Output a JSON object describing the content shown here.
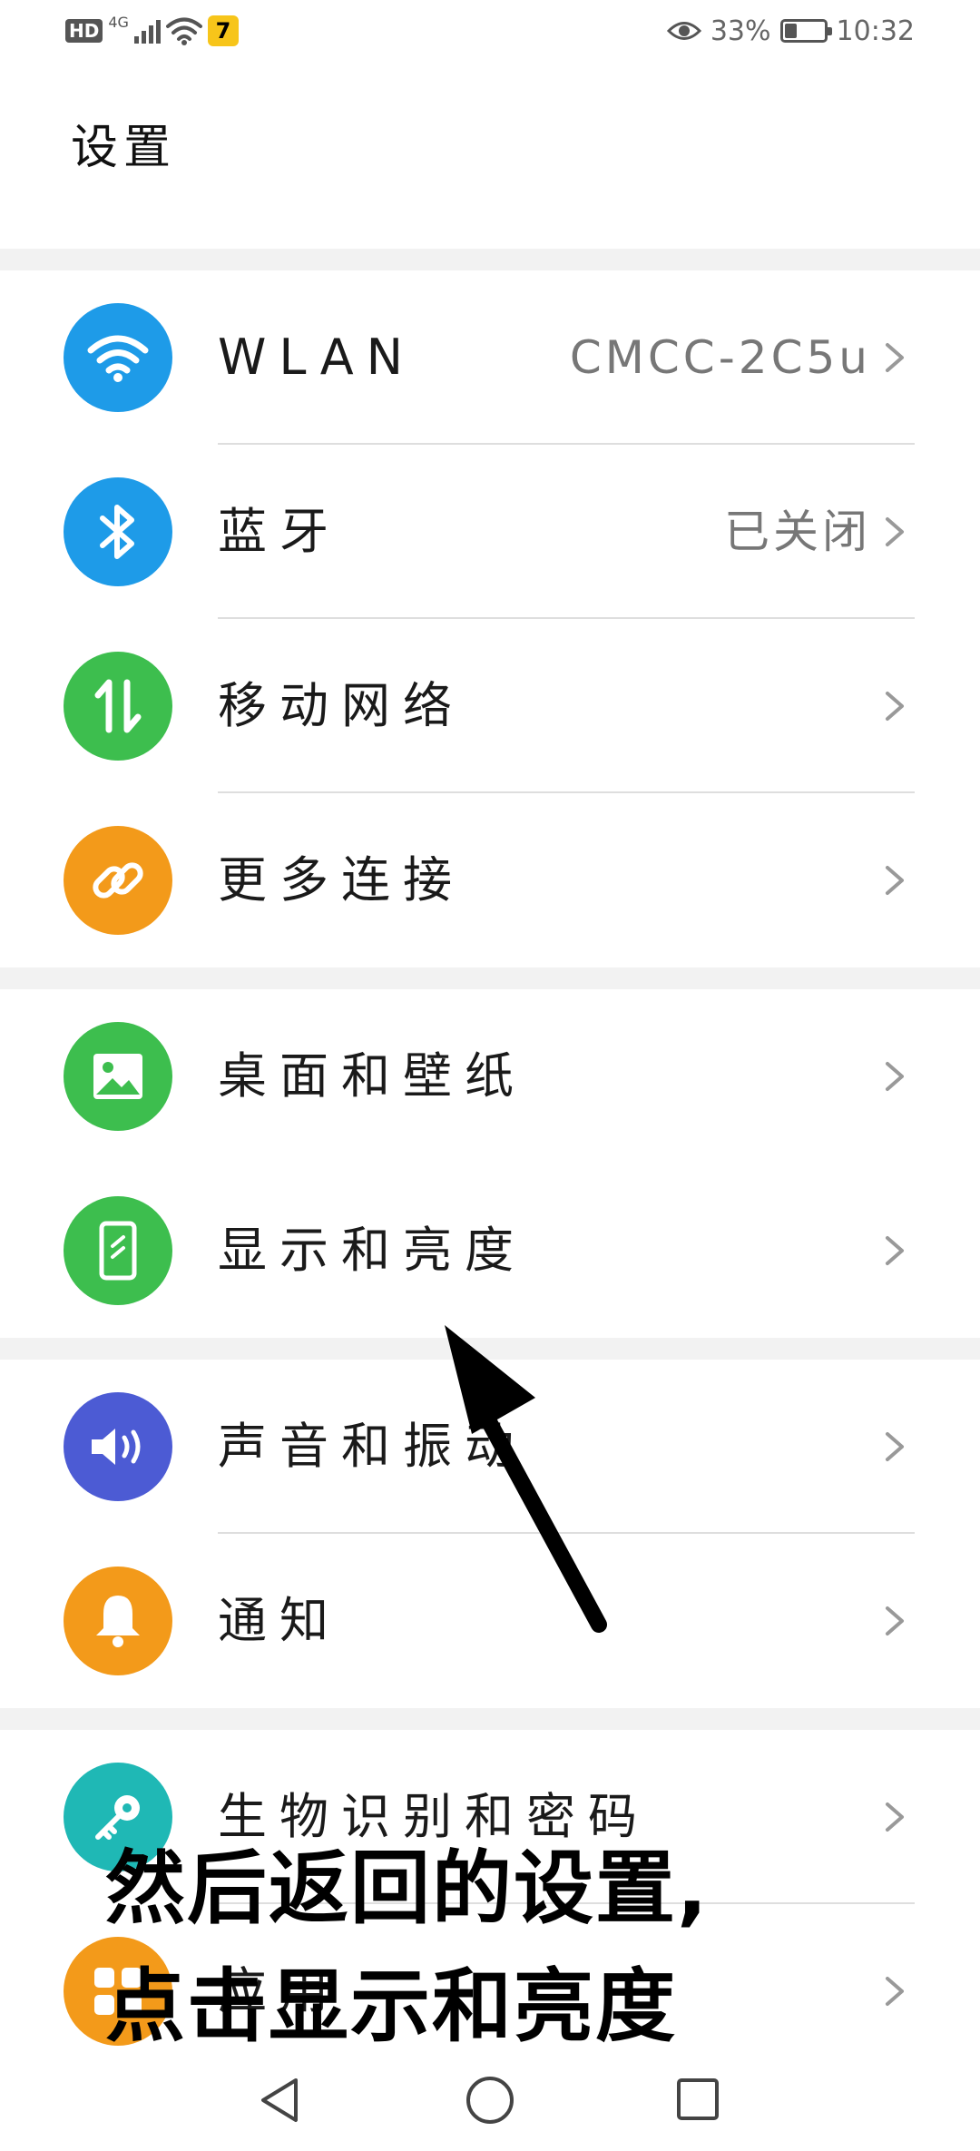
{
  "status_bar": {
    "hd": "HD",
    "network": "4G",
    "battery_text": "33%",
    "battery_level": 0.33,
    "time": "10:32"
  },
  "page": {
    "title": "设置"
  },
  "sections": [
    {
      "items": [
        {
          "label": "WLAN",
          "value": "CMCC-2C5u",
          "icon": "wifi-icon",
          "color": "#1e9be8"
        },
        {
          "label": "蓝牙",
          "value": "已关闭",
          "icon": "bluetooth-icon",
          "color": "#1e9be8"
        },
        {
          "label": "移动网络",
          "value": "",
          "icon": "mobile-data-icon",
          "color": "#3dbe4e"
        },
        {
          "label": "更多连接",
          "value": "",
          "icon": "link-icon",
          "color": "#f39a1a"
        }
      ]
    },
    {
      "items": [
        {
          "label": "桌面和壁纸",
          "value": "",
          "icon": "wallpaper-icon",
          "color": "#3dbe4e"
        },
        {
          "label": "显示和亮度",
          "value": "",
          "icon": "display-icon",
          "color": "#3dbe4e"
        }
      ]
    },
    {
      "items": [
        {
          "label": "声音和振动",
          "value": "",
          "icon": "sound-icon",
          "color": "#4c5bd4"
        },
        {
          "label": "通知",
          "value": "",
          "icon": "bell-icon",
          "color": "#f39a1a"
        }
      ]
    },
    {
      "items": [
        {
          "label": "生物识别和密码",
          "value": "",
          "icon": "key-icon",
          "color": "#1fb8b5"
        },
        {
          "label": "应用",
          "value": "",
          "icon": "apps-icon",
          "color": "#f39a1a"
        }
      ]
    }
  ],
  "annotation": {
    "line1": "然后返回的设置,",
    "line2": "点击显示和亮度"
  }
}
